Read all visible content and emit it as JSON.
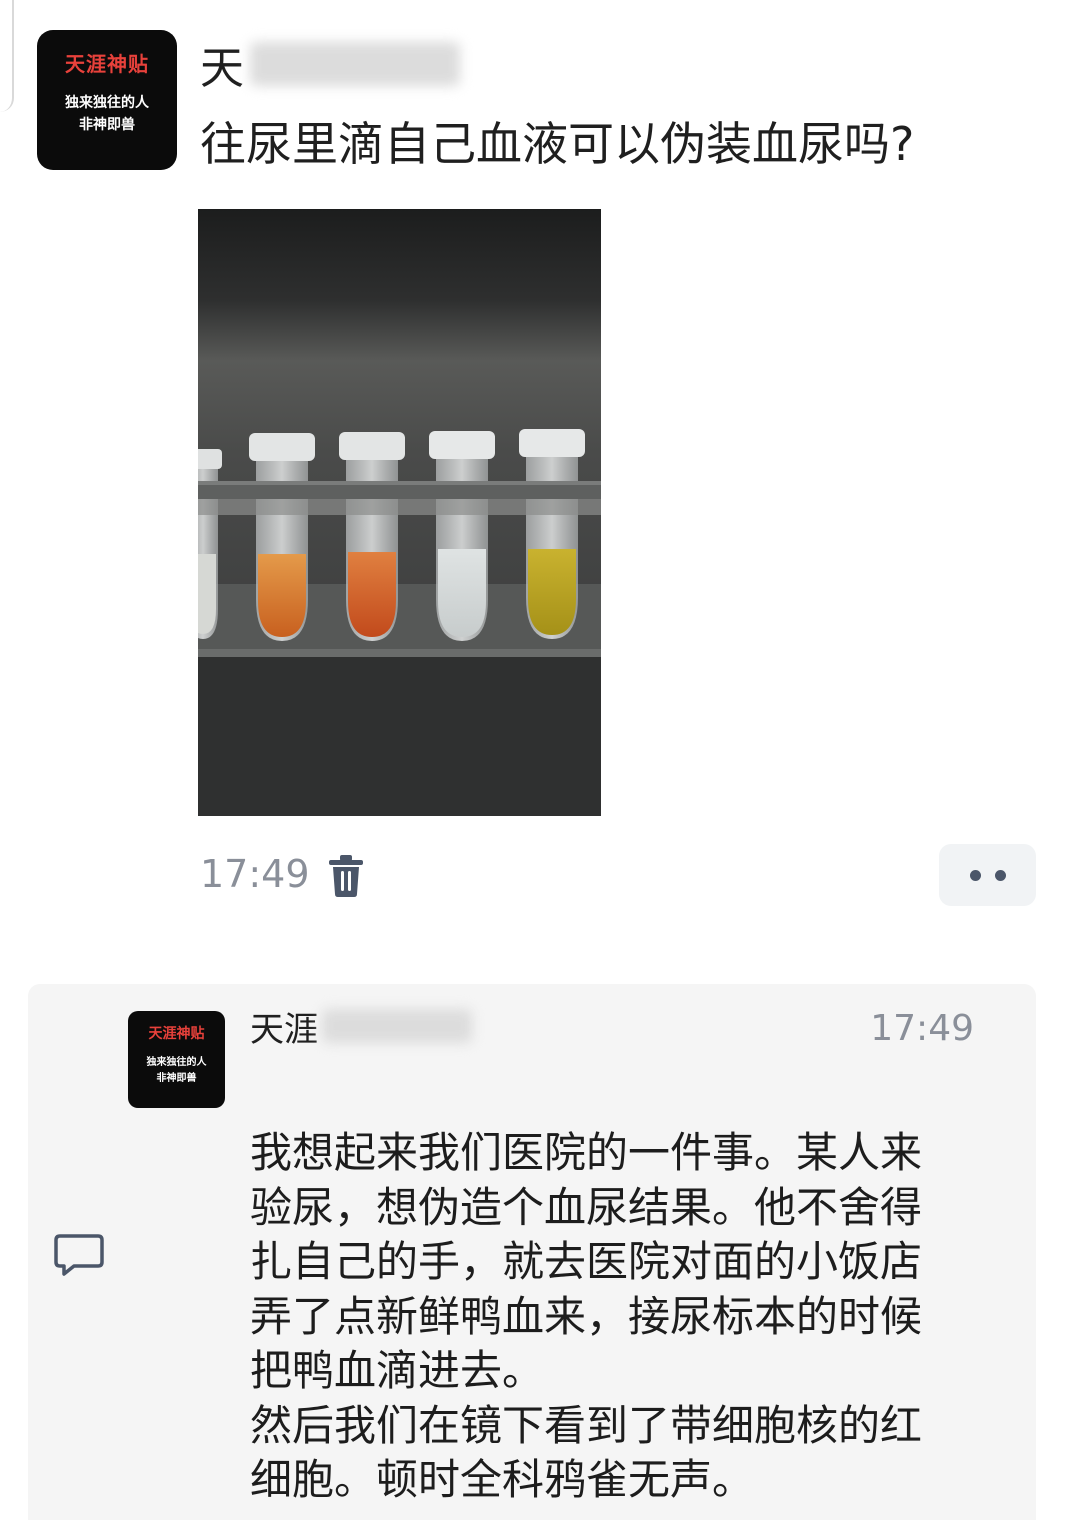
{
  "post": {
    "avatar": {
      "brand": "天涯神贴",
      "slogan_line1": "独来独往的人",
      "slogan_line2": "非神即兽"
    },
    "author_visible": "天",
    "title": "往尿里滴自己血液可以伪装血尿吗?",
    "time": "17:49",
    "icons": {
      "delete": "trash-icon",
      "more": "more-dots-icon"
    }
  },
  "comment": {
    "avatar": {
      "brand": "天涯神贴",
      "slogan_line1": "独来独往的人",
      "slogan_line2": "非神即兽"
    },
    "author_visible": "天涯",
    "time": "17:49",
    "body_lines": [
      "我想起来我们医院的一件事。某人来",
      "验尿，想伪造个血尿结果。他不舍得",
      "扎自己的手，就去医院对面的小饭店",
      "弄了点新鲜鸭血来，接尿标本的时候",
      "把鸭血滴进去。",
      "然后我们在镜下看到了带细胞核的红",
      "细胞。顿时全科鸦雀无声。"
    ],
    "icons": {
      "reply": "comment-bubble-icon"
    }
  },
  "colors": {
    "brand_red": "#e8413b",
    "icon_gray": "#4b5669",
    "time_gray": "#8a8f99"
  }
}
